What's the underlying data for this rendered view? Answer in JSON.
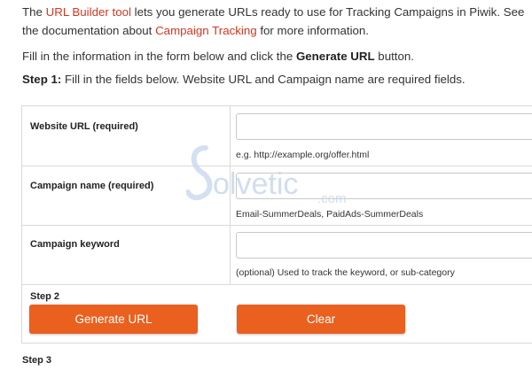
{
  "intro": {
    "prefix": "The ",
    "link1": "URL Builder tool",
    "middle": " lets you generate URLs ready to use for Tracking Campaigns in Piwik. See the documentation about ",
    "link2": "Campaign Tracking",
    "suffix": " for more information."
  },
  "instructions": {
    "p2_pre": "Fill in the information in the form below and click the ",
    "p2_bold": "Generate URL",
    "p2_post": " button.",
    "step1_bold": "Step 1:",
    "step1_text": " Fill in the fields below. Website URL and Campaign name are required fields."
  },
  "fields": [
    {
      "label": "Website URL (required)",
      "value": "",
      "hint": "e.g. http://example.org/offer.html"
    },
    {
      "label": "Campaign name (required)",
      "value": "",
      "hint": "Email-SummerDeals, PaidAds-SummerDeals"
    },
    {
      "label": "Campaign keyword",
      "value": "",
      "hint": "(optional) Used to track the keyword, or sub-category"
    }
  ],
  "step2": "Step 2",
  "buttons": {
    "generate": "Generate URL",
    "clear": "Clear"
  },
  "step3": "Step 3",
  "watermark": {
    "brand": "olvetic",
    "suffix": ".com"
  },
  "colors": {
    "accent": "#e9601f",
    "link": "#d4361f"
  }
}
